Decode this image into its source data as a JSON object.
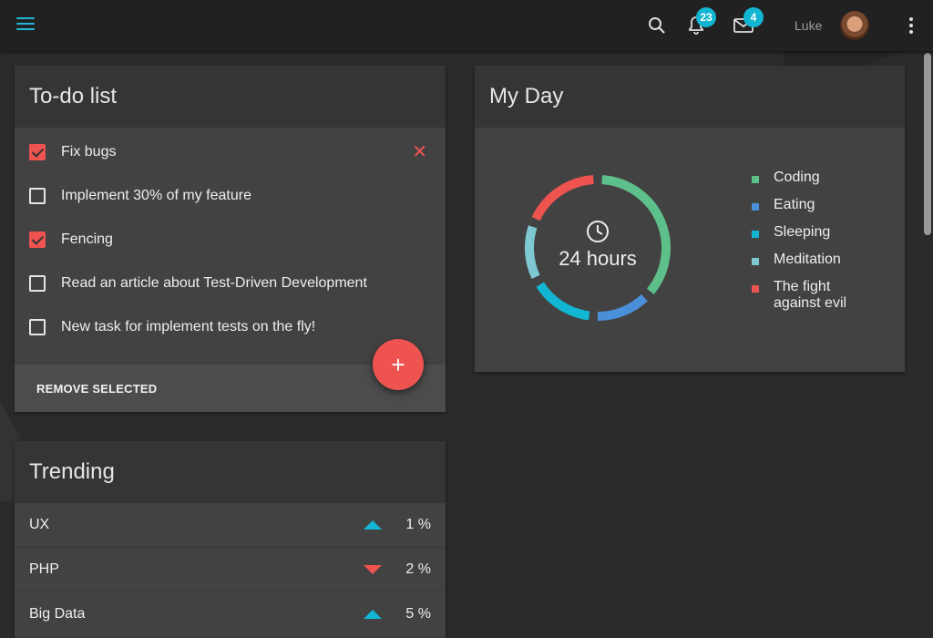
{
  "header": {
    "user_name": "Luke",
    "notifications_count": "23",
    "messages_count": "4"
  },
  "todo": {
    "title": "To-do list",
    "items": [
      {
        "text": "Fix bugs",
        "checked": true
      },
      {
        "text": "Implement 30% of my feature",
        "checked": false
      },
      {
        "text": "Fencing",
        "checked": true
      },
      {
        "text": "Read an article about Test-Driven Development",
        "checked": false
      },
      {
        "text": "New task for implement tests on the fly!",
        "checked": false
      }
    ],
    "remove_label": "REMOVE SELECTED",
    "add_label": "+"
  },
  "trending": {
    "title": "Trending",
    "rows": [
      {
        "name": "UX",
        "trend": "up",
        "value": "1 %"
      },
      {
        "name": "PHP",
        "trend": "down",
        "value": "2 %"
      },
      {
        "name": "Big Data",
        "trend": "up",
        "value": "5 %"
      }
    ]
  },
  "myday": {
    "title": "My Day",
    "center_label": "24 hours",
    "legend": [
      {
        "label": "Coding",
        "color": "#5dbf8a"
      },
      {
        "label": "Eating",
        "color": "#4a90d9"
      },
      {
        "label": "Sleeping",
        "color": "#12b6d3"
      },
      {
        "label": "Meditation",
        "color": "#7ec8d3"
      },
      {
        "label": "The fight against evil",
        "color": "#ef5350"
      }
    ],
    "segments_fraction": [
      0.37,
      0.14,
      0.16,
      0.14,
      0.19
    ]
  },
  "colors": {
    "accent": "#12b6d3",
    "danger": "#ef5350"
  }
}
